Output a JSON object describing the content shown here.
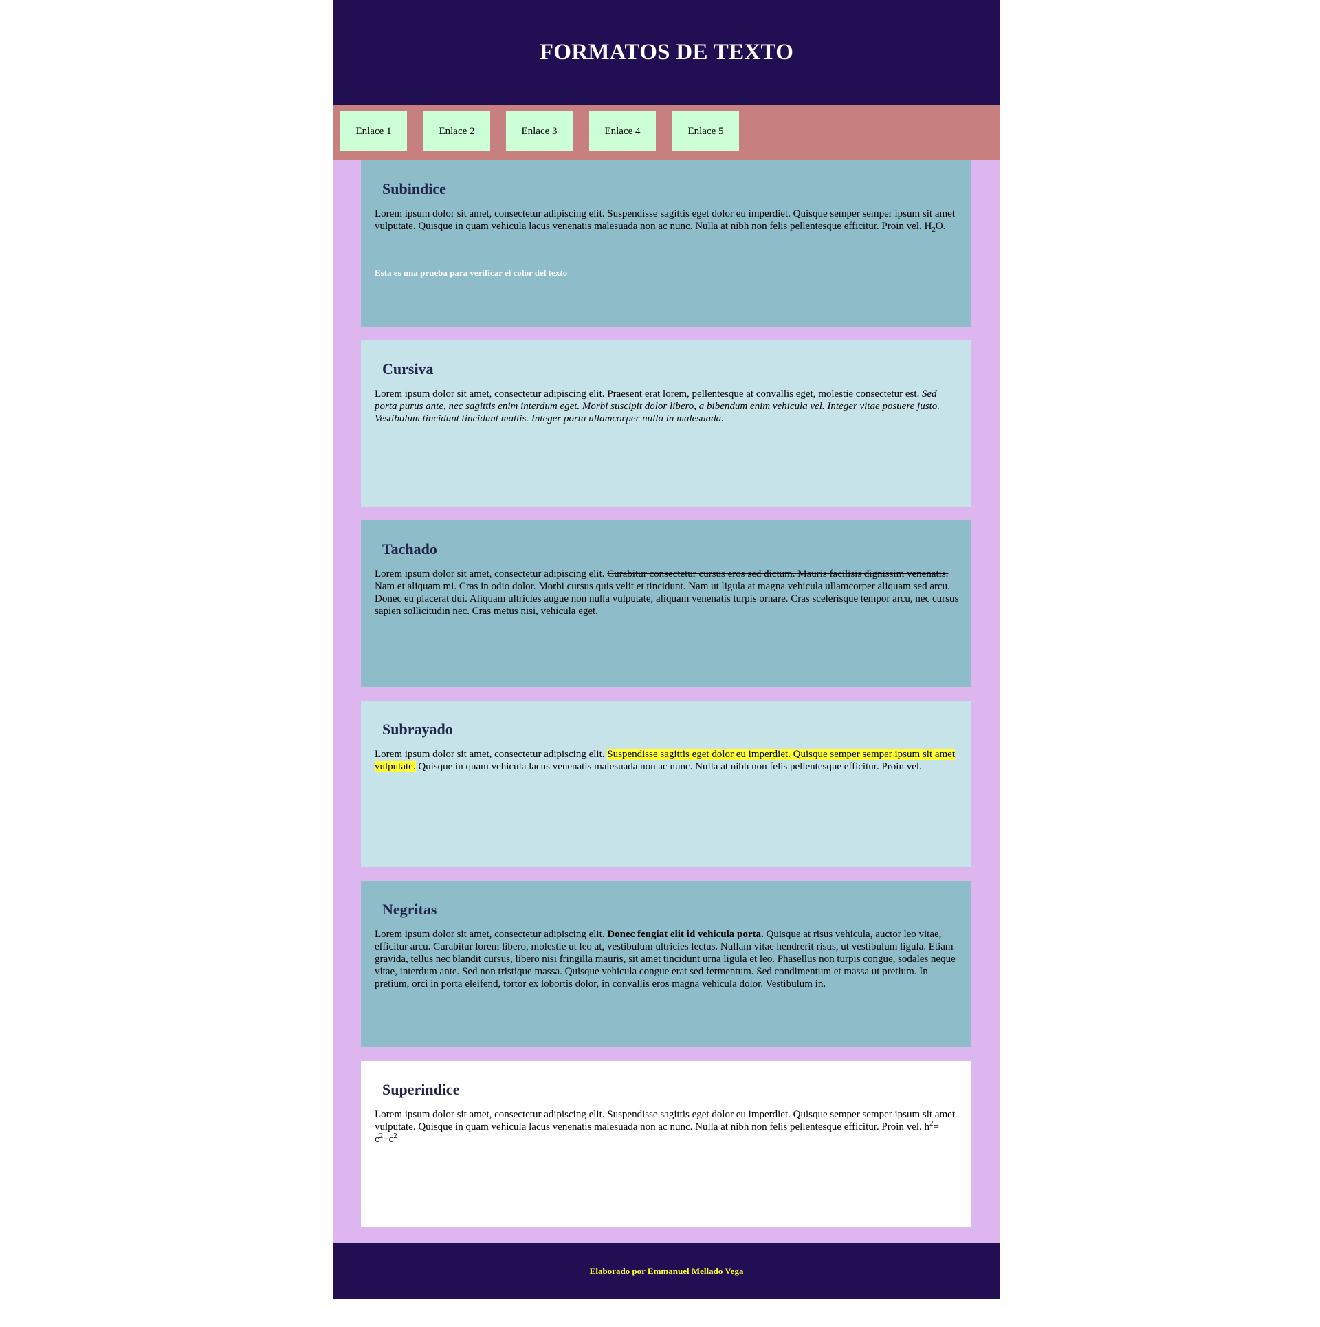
{
  "header": {
    "title": "FORMATOS DE TEXTO"
  },
  "nav": {
    "links": [
      "Enlace 1",
      "Enlace 2",
      "Enlace 3",
      "Enlace 4",
      "Enlace 5"
    ]
  },
  "sections": {
    "subindice": {
      "title": "Subindice",
      "text": "Lorem ipsum dolor sit amet, consectetur adipiscing elit. Suspendisse sagittis eget dolor eu imperdiet. Quisque semper semper ipsum sit amet vulputate. Quisque in quam vehicula lacus venenatis malesuada non ac nunc. Nulla at nibh non felis pellentesque efficitur. Proin vel. H",
      "sub": "2",
      "after": "O.",
      "note": "Esta es una prueba para verificar el color del texto"
    },
    "cursiva": {
      "title": "Cursiva",
      "text": "Lorem ipsum dolor sit amet, consectetur adipiscing elit. Praesent erat lorem, pellentesque at convallis eget, molestie consectetur est. ",
      "italic": "Sed porta purus ante, nec sagittis enim interdum eget. Morbi suscipit dolor libero, a bibendum enim vehicula vel. Integer vitae posuere justo. Vestibulum tincidunt tincidunt mattis. Integer porta ullamcorper nulla in malesuada."
    },
    "tachado": {
      "title": "Tachado",
      "text": "Lorem ipsum dolor sit amet, consectetur adipiscing elit. ",
      "strike": "Curabitur consectetur cursus eros sed dictum. Mauris facilisis dignissim venenatis. Nam et aliquam mi. Cras in odio dolor.",
      "after": " Morbi cursus quis velit et tincidunt. Nam ut ligula at magna vehicula ullamcorper aliquam sed arcu. Donec eu placerat dui. Aliquam ultricies augue non nulla vulputate, aliquam venenatis turpis ornare. Cras scelerisque tempor arcu, nec cursus sapien sollicitudin nec. Cras metus nisi, vehicula eget."
    },
    "subrayado": {
      "title": "Subrayado",
      "text": "Lorem ipsum dolor sit amet, consectetur adipiscing elit. ",
      "highlight": "Suspendisse sagittis eget dolor eu imperdiet. Quisque semper semper ipsum sit amet vulputate.",
      "after": " Quisque in quam vehicula lacus venenatis malesuada non ac nunc. Nulla at nibh non felis pellentesque efficitur. Proin vel."
    },
    "negritas": {
      "title": "Negritas",
      "text": "Lorem ipsum dolor sit amet, consectetur adipiscing elit. ",
      "bold": "Donec feugiat elit id vehicula porta.",
      "after": " Quisque at risus vehicula, auctor leo vitae, efficitur arcu. Curabitur lorem libero, molestie ut leo at, vestibulum ultricies lectus. Nullam vitae hendrerit risus, ut vestibulum ligula. Etiam gravida, tellus nec blandit cursus, libero nisi fringilla mauris, sit amet tincidunt urna ligula et leo. Phasellus non turpis congue, sodales neque vitae, interdum ante. Sed non tristique massa. Quisque vehicula congue erat sed fermentum. Sed condimentum et massa ut pretium. In pretium, orci in porta eleifend, tortor ex lobortis dolor, in convallis eros magna vehicula dolor. Vestibulum in."
    },
    "superindice": {
      "title": "Superindice",
      "text": "Lorem ipsum dolor sit amet, consectetur adipiscing elit. Suspendisse sagittis eget dolor eu imperdiet. Quisque semper semper ipsum sit amet vulputate. Quisque in quam vehicula lacus venenatis malesuada non ac nunc. Nulla at nibh non felis pellentesque efficitur. Proin vel. h",
      "sup1": "2",
      "mid": "= c",
      "sup2": "2",
      "mid2": "+c",
      "sup3": "2"
    }
  },
  "footer": {
    "text": "Elaborado por Emmanuel Mellado Vega"
  },
  "colors": {
    "header_bg": "#220e52",
    "nav_bg": "#c77f7f",
    "link_bg": "#ccffd6",
    "content_bg": "#ddb5ef",
    "card_dark": "#8ebcc9",
    "card_light": "#c5e3e9",
    "highlight": "#ffff33",
    "footer_text": "#ffff33"
  }
}
